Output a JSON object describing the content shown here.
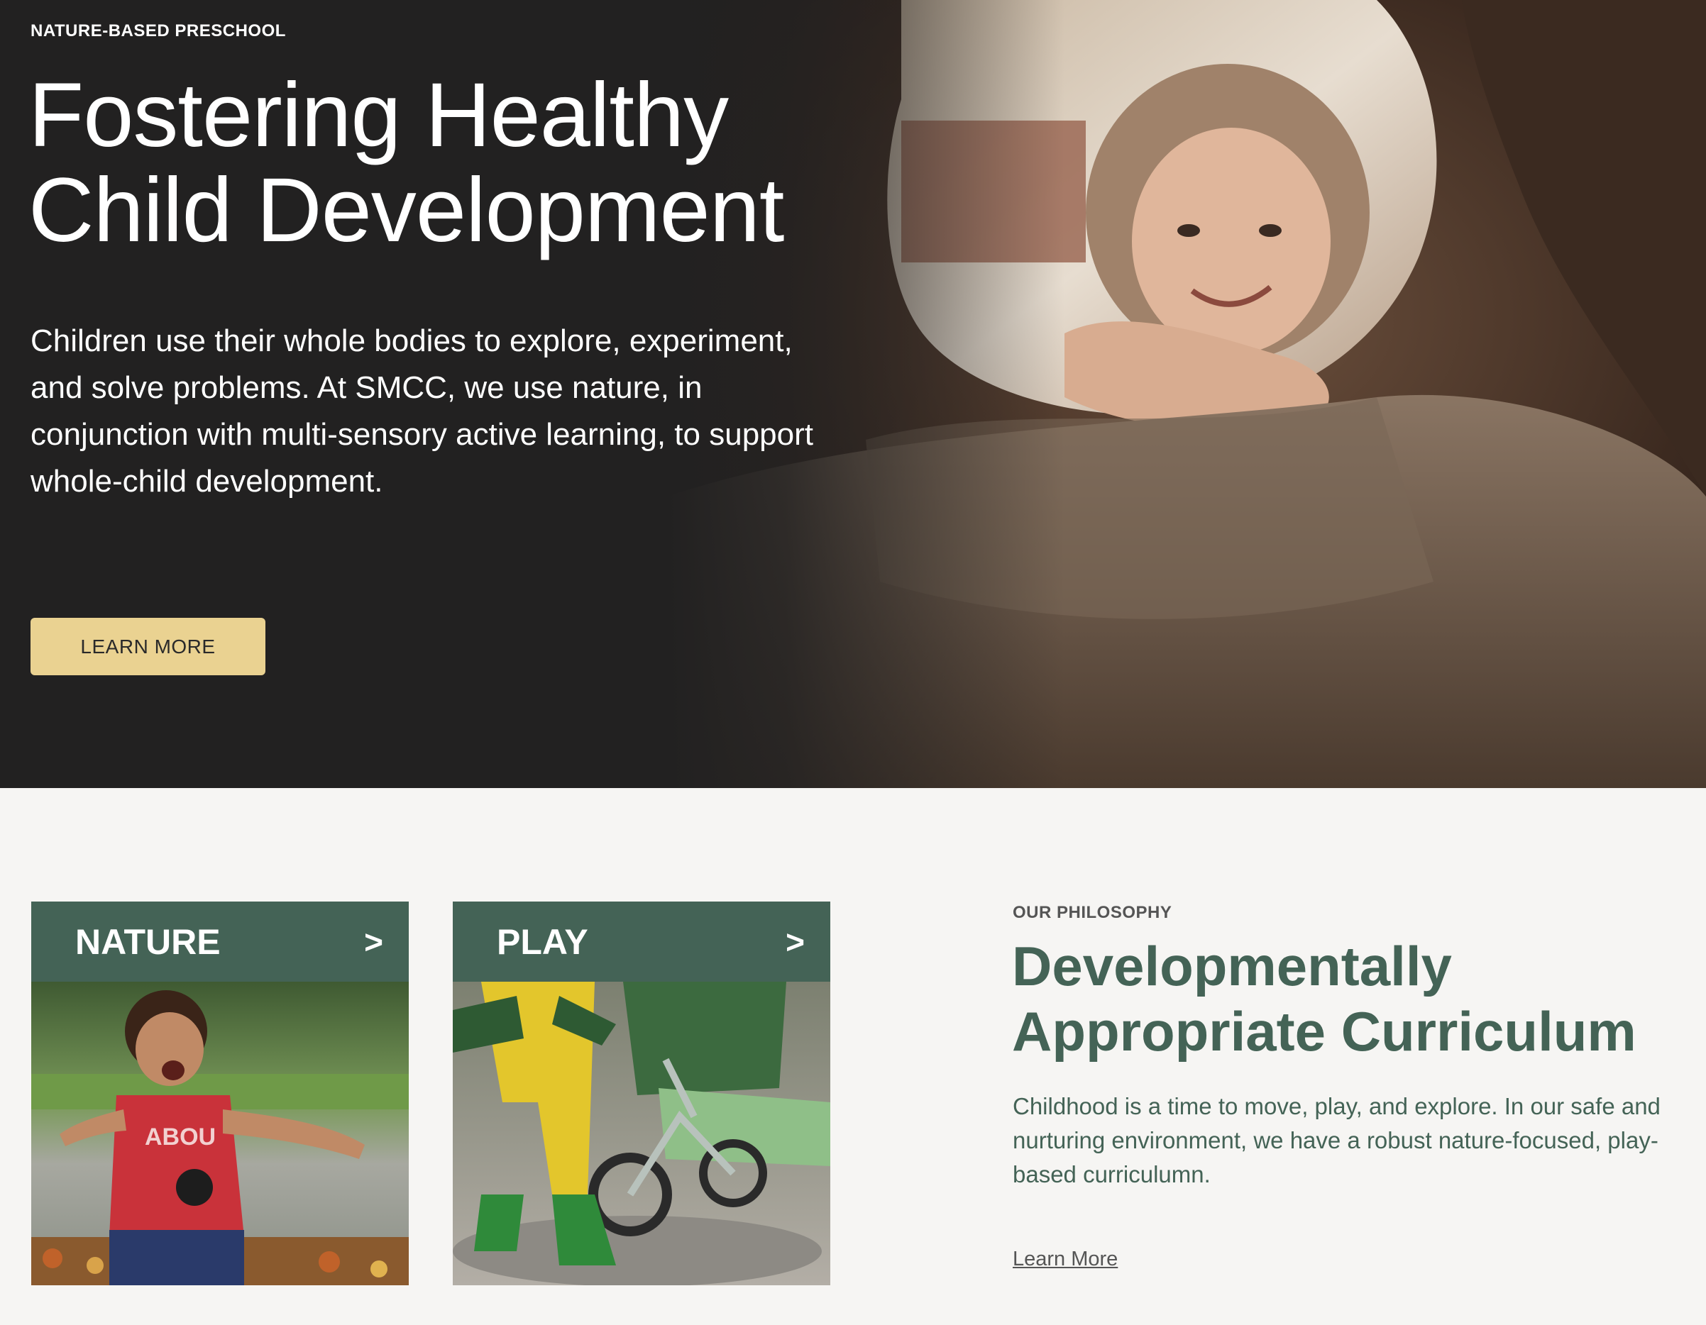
{
  "hero": {
    "eyebrow": "NATURE-BASED PRESCHOOL",
    "title_line1": "Fostering Healthy",
    "title_line2": "Child Development",
    "body": "Children use their whole bodies to explore, experiment, and solve problems. At SMCC, we use nature, in conjunction with multi-sensory active learning, to support whole-child development.",
    "button_label": "LEARN MORE"
  },
  "cards": [
    {
      "label": "NATURE",
      "chevron": ">",
      "shirt_text": "ABOU"
    },
    {
      "label": "PLAY",
      "chevron": ">"
    }
  ],
  "philosophy": {
    "eyebrow": "OUR PHILOSOPHY",
    "title_line1": "Developmentally",
    "title_line2": "Appropriate Curriculum",
    "body": "Childhood is a time to move, play, and explore. In our safe and nurturing environment, we have a robust nature-focused, play-based curriculumn.",
    "link_label": "Learn More"
  },
  "colors": {
    "hero_bg": "#222121",
    "button_bg": "#ead291",
    "accent_green": "#446356",
    "section_bg": "#f6f5f3"
  }
}
